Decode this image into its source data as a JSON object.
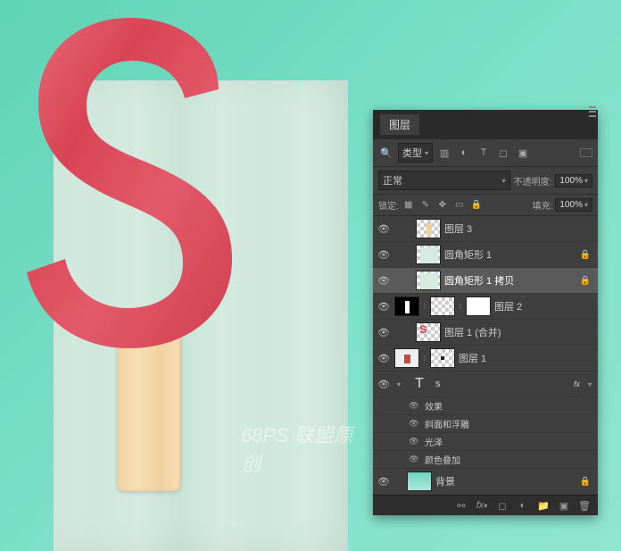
{
  "watermark": "68PS 联盟原创",
  "panel": {
    "title": "图层",
    "filter_label": "类型",
    "blend_mode": "正常",
    "opacity_label": "不透明度:",
    "opacity_value": "100%",
    "lock_label": "锁定:",
    "fill_label": "填充:",
    "fill_value": "100%"
  },
  "layers": [
    {
      "name": "图层 3",
      "thumb": "stick-t",
      "checker": true
    },
    {
      "name": "圆角矩形 1",
      "thumb": "rrect",
      "checker": true,
      "locked": true
    },
    {
      "name": "圆角矩形 1 拷贝",
      "thumb": "rrect",
      "checker": true,
      "locked": true,
      "selected": true
    },
    {
      "name": "图层 2",
      "maskpair": true
    },
    {
      "name": "图层 1 (合并)",
      "thumb": "tiny-s",
      "checker": true
    },
    {
      "name": "图层 1",
      "thumb": "dot",
      "checker": true,
      "maskpair2": true
    },
    {
      "name": "s",
      "type": "text",
      "fx": true
    },
    {
      "name": "背景",
      "thumb": "bg-thumb",
      "locked": true
    }
  ],
  "effects": {
    "title": "效果",
    "items": [
      "斜面和浮雕",
      "光泽",
      "颜色叠加"
    ]
  }
}
